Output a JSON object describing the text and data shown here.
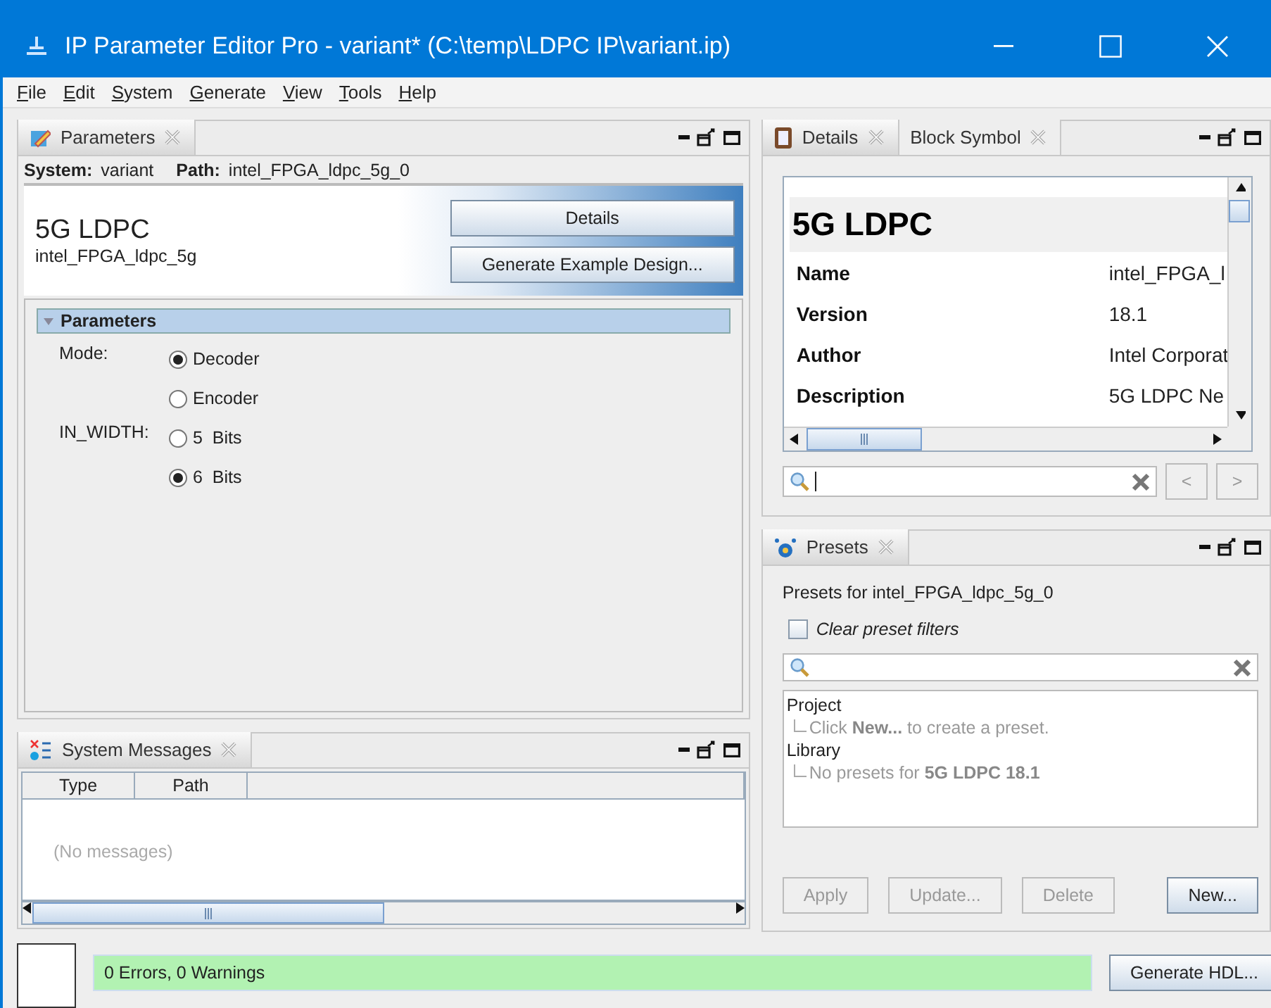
{
  "window": {
    "title": "IP Parameter Editor Pro - variant* (C:\\temp\\LDPC IP\\variant.ip)"
  },
  "menu": [
    {
      "label": "File"
    },
    {
      "label": "Edit"
    },
    {
      "label": "System"
    },
    {
      "label": "Generate"
    },
    {
      "label": "View"
    },
    {
      "label": "Tools"
    },
    {
      "label": "Help"
    }
  ],
  "parameters_panel": {
    "tabs": [
      {
        "label": "Parameters",
        "selected": true
      }
    ],
    "system_label": "System:",
    "system": "variant",
    "path_label": "Path:",
    "path": "intel_FPGA_ldpc_5g_0",
    "component": {
      "title": "5G LDPC",
      "name": "intel_FPGA_ldpc_5g"
    },
    "buttons": [
      {
        "label": "Details"
      },
      {
        "label": "Generate Example Design..."
      }
    ],
    "group": {
      "title": "Parameters",
      "expanded": true
    },
    "params": [
      {
        "label": "Mode:",
        "options": [
          {
            "label": "Decoder",
            "selected": true
          },
          {
            "label": "Encoder",
            "selected": false
          }
        ]
      },
      {
        "label": "IN_WIDTH:",
        "options": [
          {
            "label": "5  Bits",
            "selected": false
          },
          {
            "label": "6  Bits",
            "selected": true
          }
        ]
      }
    ]
  },
  "messages_panel": {
    "tabs": [
      {
        "label": "System Messages",
        "selected": true
      }
    ],
    "columns": [
      "Type",
      "Path"
    ],
    "empty_text": "(No messages)"
  },
  "details_panel": {
    "tabs": [
      {
        "label": "Details",
        "selected": true
      },
      {
        "label": "Block Symbol",
        "selected": false
      }
    ],
    "heading": "5G LDPC",
    "rows": [
      {
        "label": "Name",
        "value": "intel_FPGA_l"
      },
      {
        "label": "Version",
        "value": "18.1"
      },
      {
        "label": "Author",
        "value": "Intel Corporat"
      },
      {
        "label": "Description",
        "value": "5G LDPC Ne"
      }
    ],
    "nav_buttons": [
      {
        "label": "<",
        "disabled": true
      },
      {
        "label": ">",
        "disabled": true
      }
    ]
  },
  "presets_panel": {
    "tabs": [
      {
        "label": "Presets",
        "selected": true
      }
    ],
    "caption": "Presets for intel_FPGA_ldpc_5g_0",
    "filter": {
      "label": "Clear preset filters",
      "checked": false
    },
    "tree": [
      {
        "label": "Project",
        "children": [
          {
            "label": "Click **New...** to create a preset."
          }
        ]
      },
      {
        "label": "Library",
        "children": [
          {
            "label": "No presets for **5G LDPC 18.1**"
          }
        ]
      }
    ],
    "buttons": [
      {
        "label": "Apply",
        "disabled": true
      },
      {
        "label": "Update...",
        "disabled": true
      },
      {
        "label": "Delete",
        "disabled": true
      },
      {
        "label": "New...",
        "disabled": false
      }
    ]
  },
  "status_bar": {
    "text": "0 Errors, 0 Warnings",
    "button": "Generate HDL..."
  }
}
